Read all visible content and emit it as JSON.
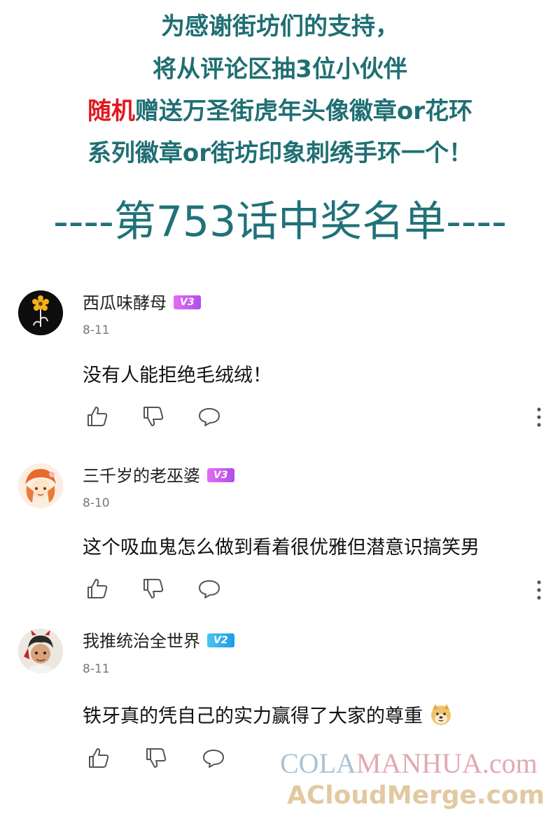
{
  "announcement": {
    "line1": "为感谢街坊们的支持，",
    "line2": "将从评论区抽3位小伙伴",
    "line3_red": "随机",
    "line3_rest": "赠送万圣街虎年头像徽章or花环",
    "line4": "系列徽章or街坊印象刺绣手环一个！"
  },
  "banner": "----第753话中奖名单----",
  "comments": [
    {
      "username": "西瓜味酵母",
      "level": "V3",
      "date": "8-11",
      "text": "没有人能拒绝毛绒绒！"
    },
    {
      "username": "三千岁的老巫婆",
      "level": "V3",
      "date": "8-10",
      "text": "这个吸血鬼怎么做到看着很优雅但潜意识搞笑男"
    },
    {
      "username": "我推统治全世界",
      "level": "V2",
      "date": "8-11",
      "text": "铁牙真的凭自己的实力赢得了大家的尊重"
    }
  ],
  "watermark": {
    "part1": "COLA",
    "part2": "MANHUA.com",
    "line2": "ACloudMerge.com"
  },
  "colors": {
    "headline": "#1f6f73",
    "highlight": "#e3161f",
    "badge_v3": "#c85bee",
    "badge_v2": "#2aa8ea"
  }
}
